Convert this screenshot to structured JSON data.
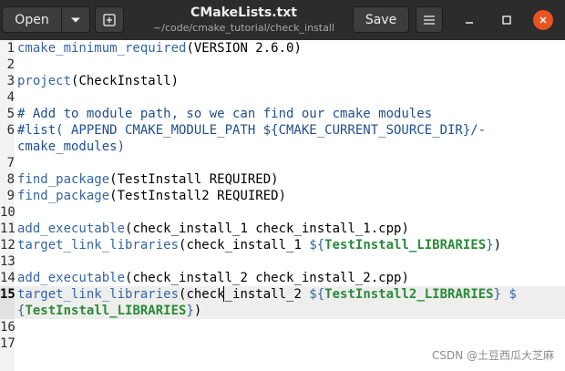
{
  "header": {
    "open_label": "Open",
    "save_label": "Save",
    "title": "CMakeLists.txt",
    "subtitle": "~/code/cmake_tutorial/check_install"
  },
  "icons": {
    "open_menu": "chevron-down-icon",
    "new_tab": "new-tab-icon",
    "menu": "hamburger-menu-icon",
    "minimize": "minimize-icon",
    "maximize": "maximize-icon",
    "close": "close-icon"
  },
  "editor": {
    "current_line": 15,
    "lines": [
      {
        "n": "1",
        "parts": [
          {
            "t": "cmake_minimum_required",
            "c": "fn"
          },
          {
            "t": "(VERSION 2.6.0)",
            "c": "txt"
          }
        ]
      },
      {
        "n": "2",
        "parts": []
      },
      {
        "n": "3",
        "parts": [
          {
            "t": "project",
            "c": "fn"
          },
          {
            "t": "(CheckInstall)",
            "c": "txt"
          }
        ]
      },
      {
        "n": "4",
        "parts": []
      },
      {
        "n": "5",
        "parts": [
          {
            "t": "# Add to module path, so we can find our cmake modules",
            "c": "cm"
          }
        ]
      },
      {
        "n": "6",
        "parts": [
          {
            "t": "#list( APPEND CMAKE_MODULE_PATH ${CMAKE_CURRENT_SOURCE_DIR}/-",
            "c": "cm"
          }
        ]
      },
      {
        "n": "",
        "parts": [
          {
            "t": "cmake_modules)",
            "c": "cm"
          }
        ]
      },
      {
        "n": "7",
        "parts": []
      },
      {
        "n": "8",
        "parts": [
          {
            "t": "find_package",
            "c": "fn"
          },
          {
            "t": "(TestInstall REQUIRED)",
            "c": "txt"
          }
        ]
      },
      {
        "n": "9",
        "parts": [
          {
            "t": "find_package",
            "c": "fn"
          },
          {
            "t": "(TestInstall2 REQUIRED)",
            "c": "txt"
          }
        ]
      },
      {
        "n": "10",
        "parts": []
      },
      {
        "n": "11",
        "parts": [
          {
            "t": "add_executable",
            "c": "fn"
          },
          {
            "t": "(check_install_1 check_install_1.cpp)",
            "c": "txt"
          }
        ]
      },
      {
        "n": "12",
        "parts": [
          {
            "t": "target_link_libraries",
            "c": "fn"
          },
          {
            "t": "(check_install_1 ",
            "c": "txt"
          },
          {
            "t": "${",
            "c": "fn"
          },
          {
            "t": "TestInstall_LIBRARIES",
            "c": "var"
          },
          {
            "t": "}",
            "c": "fn"
          },
          {
            "t": ")",
            "c": "txt"
          }
        ]
      },
      {
        "n": "13",
        "parts": []
      },
      {
        "n": "14",
        "parts": [
          {
            "t": "add_executable",
            "c": "fn"
          },
          {
            "t": "(check_install_2 check_install_2.cpp)",
            "c": "txt"
          }
        ]
      },
      {
        "n": "15",
        "parts": [
          {
            "t": "target_link_libraries",
            "c": "fn"
          },
          {
            "t": "(check_install_2 ",
            "c": "txt"
          },
          {
            "t": "${",
            "c": "fn"
          },
          {
            "t": "TestInstall2_LIBRARIES",
            "c": "var"
          },
          {
            "t": "} $",
            "c": "fn"
          }
        ],
        "wrap": [
          {
            "t": "{",
            "c": "fn"
          },
          {
            "t": "TestInstall_LIBRARIES",
            "c": "var"
          },
          {
            "t": "}",
            "c": "fn"
          },
          {
            "t": ")",
            "c": "txt"
          }
        ]
      },
      {
        "n": "16",
        "parts": []
      },
      {
        "n": "17",
        "parts": []
      }
    ]
  },
  "watermark": "CSDN @土豆西瓜大芝麻"
}
